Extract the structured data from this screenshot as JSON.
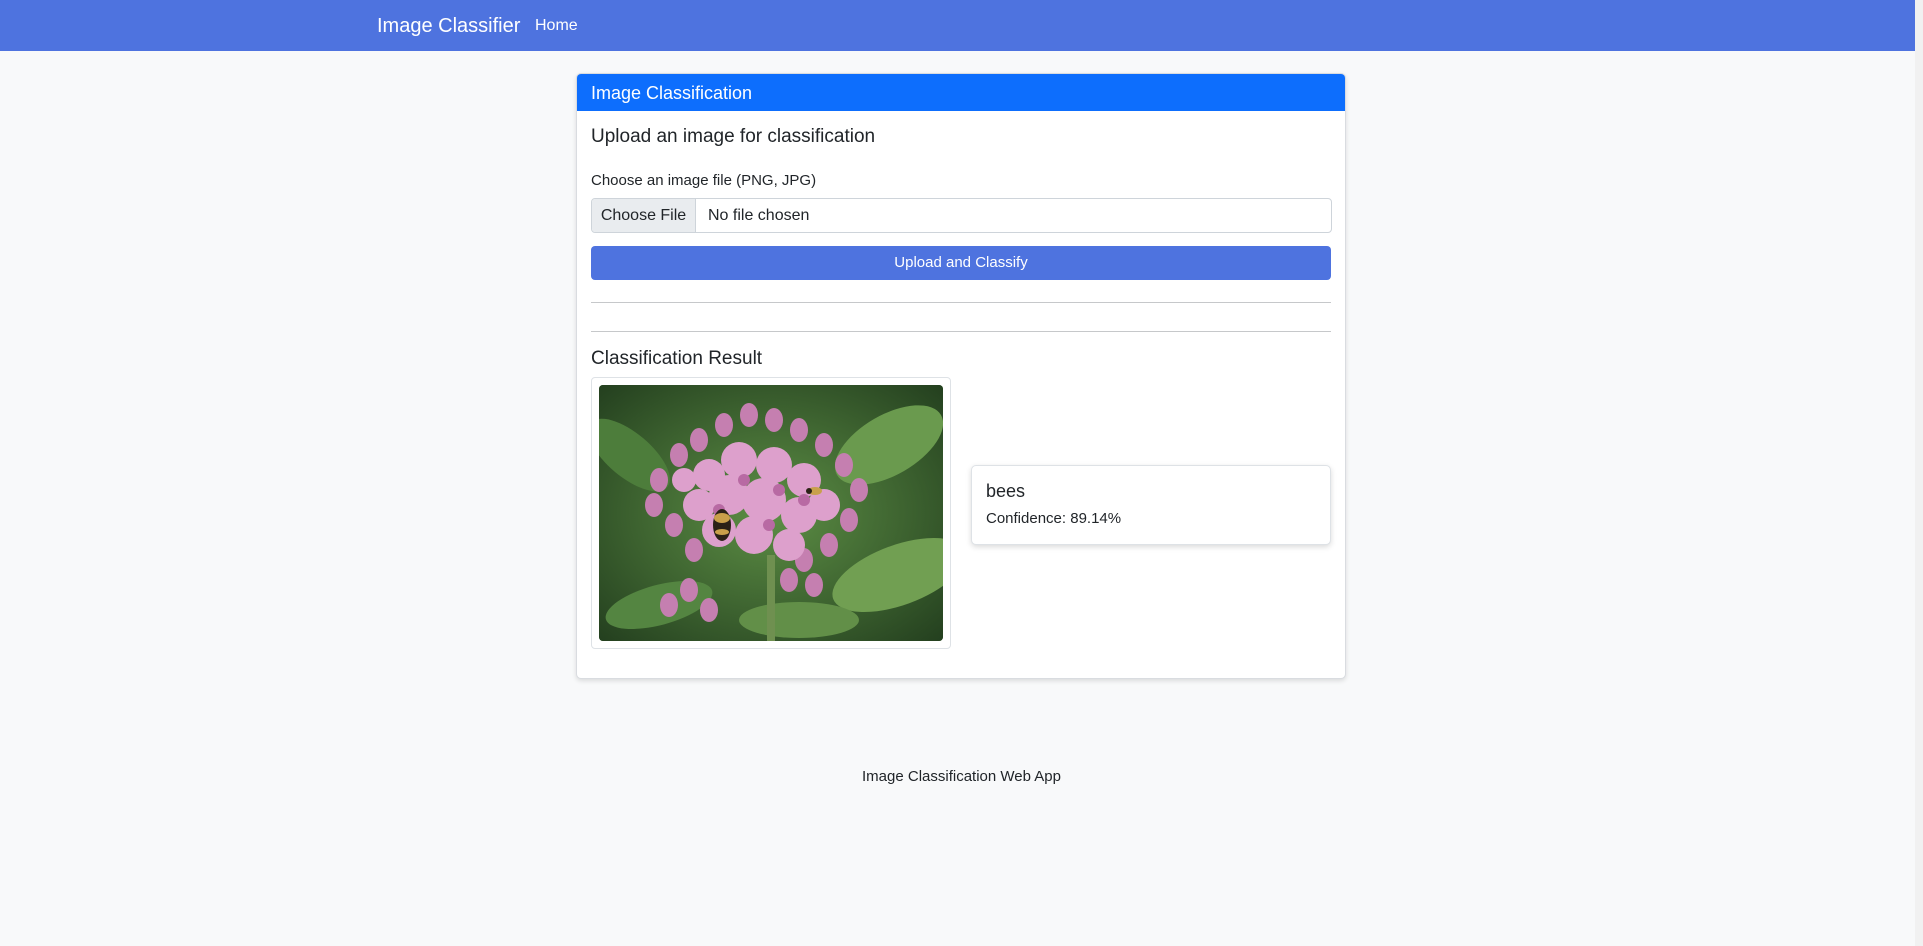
{
  "navbar": {
    "brand": "Image Classifier",
    "links": [
      "Home"
    ]
  },
  "card": {
    "header_title": "Image Classification",
    "upload_heading": "Upload an image for classification",
    "file_label": "Choose an image file (PNG, JPG)",
    "file_button_label": "Choose File",
    "file_status": "No file chosen",
    "submit_label": "Upload and Classify",
    "result_heading": "Classification Result",
    "prediction": {
      "label": "bees",
      "confidence_text": "Confidence: 89.14%"
    }
  },
  "footer": {
    "text": "Image Classification Web App"
  },
  "colors": {
    "navbar": "#4e73df",
    "card_header": "#0d6efd",
    "button": "#4e73df",
    "background": "#f8f9fa"
  }
}
